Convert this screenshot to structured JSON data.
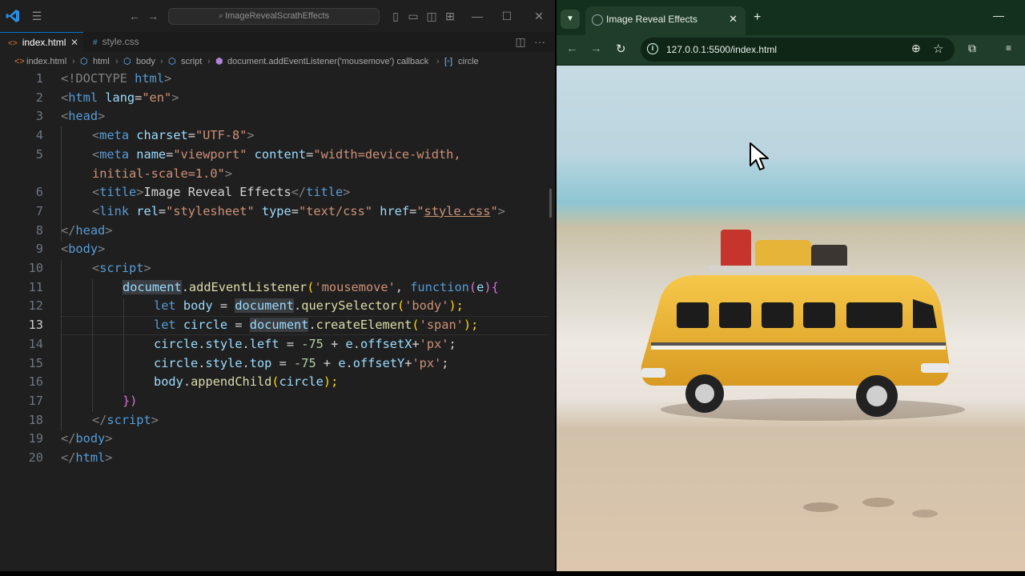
{
  "vscode": {
    "search_text": "ImageRevealScrathEffects",
    "tabs": [
      {
        "label": "index.html",
        "active": true
      },
      {
        "label": "style.css",
        "active": false
      }
    ],
    "breadcrumb": [
      "index.html",
      "html",
      "body",
      "script",
      "document.addEventListener('mousemove') callback",
      "circle"
    ],
    "current_line": 13,
    "line_numbers": [
      "1",
      "2",
      "3",
      "4",
      "5",
      "",
      "6",
      "7",
      "8",
      "9",
      "10",
      "11",
      "12",
      "13",
      "14",
      "15",
      "16",
      "17",
      "18",
      "19",
      "20"
    ],
    "code": {
      "l1": [
        "<!DOCTYPE ",
        "html",
        ">"
      ],
      "l2": [
        "<",
        "html",
        " ",
        "lang",
        "=",
        "\"en\"",
        ">"
      ],
      "l3": [
        "<",
        "head",
        ">"
      ],
      "l4": [
        "<",
        "meta",
        " ",
        "charset",
        "=",
        "\"UTF-8\"",
        ">"
      ],
      "l5": [
        "<",
        "meta",
        " ",
        "name",
        "=",
        "\"viewport\"",
        " ",
        "content",
        "=",
        "\"width=device-width,"
      ],
      "l5b": [
        "initial-scale=1.0\"",
        ">"
      ],
      "l6": [
        "<",
        "title",
        ">",
        "Image Reveal Effects",
        "</",
        "title",
        ">"
      ],
      "l7": [
        "<",
        "link",
        " ",
        "rel",
        "=",
        "\"stylesheet\"",
        " ",
        "type",
        "=",
        "\"text/css\"",
        " ",
        "href",
        "=",
        "\"",
        "style.css",
        "\"",
        ">"
      ],
      "l8": [
        "</",
        "head",
        ">"
      ],
      "l9": [
        "<",
        "body",
        ">"
      ],
      "l10": [
        "<",
        "script",
        ">"
      ],
      "l11": [
        "document",
        ".",
        "addEventListener",
        "(",
        "'mousemove'",
        ", ",
        "function",
        "(",
        "e",
        ")",
        "{"
      ],
      "l12": [
        "let",
        " ",
        "body",
        " = ",
        "document",
        ".",
        "querySelector",
        "(",
        "'body'",
        ");"
      ],
      "l13": [
        "let",
        " ",
        "circle",
        " = ",
        "document",
        ".",
        "createElement",
        "(",
        "'span'",
        ");"
      ],
      "l14": [
        "circle",
        ".",
        "style",
        ".",
        "left",
        " = ",
        "-75",
        " + ",
        "e",
        ".",
        "offsetX",
        "+",
        "'px'",
        ";"
      ],
      "l15": [
        "circle",
        ".",
        "style",
        ".",
        "top",
        " = ",
        "-75",
        " + ",
        "e",
        ".",
        "offsetY",
        "+",
        "'px'",
        ";"
      ],
      "l16": [
        "body",
        ".",
        "appendChild",
        "(",
        "circle",
        ");"
      ],
      "l17": [
        "})"
      ],
      "l18": [
        "</",
        "script",
        ">"
      ],
      "l19": [
        "</",
        "body",
        ">"
      ],
      "l20": [
        "</",
        "html",
        ">"
      ]
    }
  },
  "browser": {
    "tab_title": "Image Reveal Effects",
    "url": "127.0.0.1:5500/index.html"
  },
  "icons": {
    "vscode_logo": "vscode-logo-icon",
    "menu": "hamburger-icon",
    "back": "arrow-left-icon",
    "forward": "arrow-right-icon",
    "reload": "reload-icon",
    "zoom": "zoom-icon",
    "bookmark": "star-icon",
    "extensions": "puzzle-icon"
  },
  "colors": {
    "editor_bg": "#1f1f1f",
    "accent": "#0078d4",
    "browser_frame": "#1f3d28"
  }
}
